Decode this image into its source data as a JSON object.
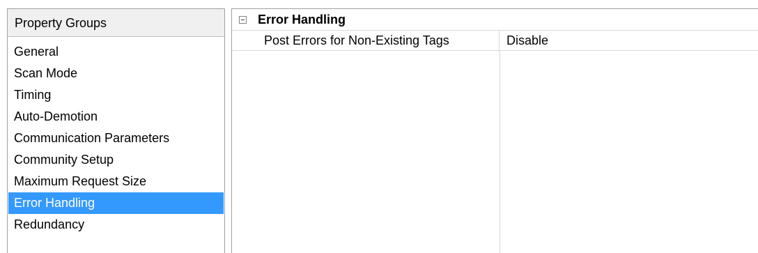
{
  "property_groups": {
    "header": "Property Groups",
    "items": [
      {
        "label": "General"
      },
      {
        "label": "Scan Mode"
      },
      {
        "label": "Timing"
      },
      {
        "label": "Auto-Demotion"
      },
      {
        "label": "Communication Parameters"
      },
      {
        "label": "Community Setup"
      },
      {
        "label": "Maximum Request Size"
      },
      {
        "label": "Error Handling"
      },
      {
        "label": "Redundancy"
      }
    ],
    "selected": "Error Handling"
  },
  "property_grid": {
    "category": {
      "title": "Error Handling",
      "expanded": true,
      "icon": "collapse-minus-icon"
    },
    "properties": [
      {
        "name": "Post Errors for Non-Existing Tags",
        "value": "Disable"
      }
    ]
  },
  "colors": {
    "selection_bg": "#3399ff",
    "selection_text": "#ffffff",
    "header_bg": "#f0f0f0",
    "border": "#a0a0a0"
  }
}
